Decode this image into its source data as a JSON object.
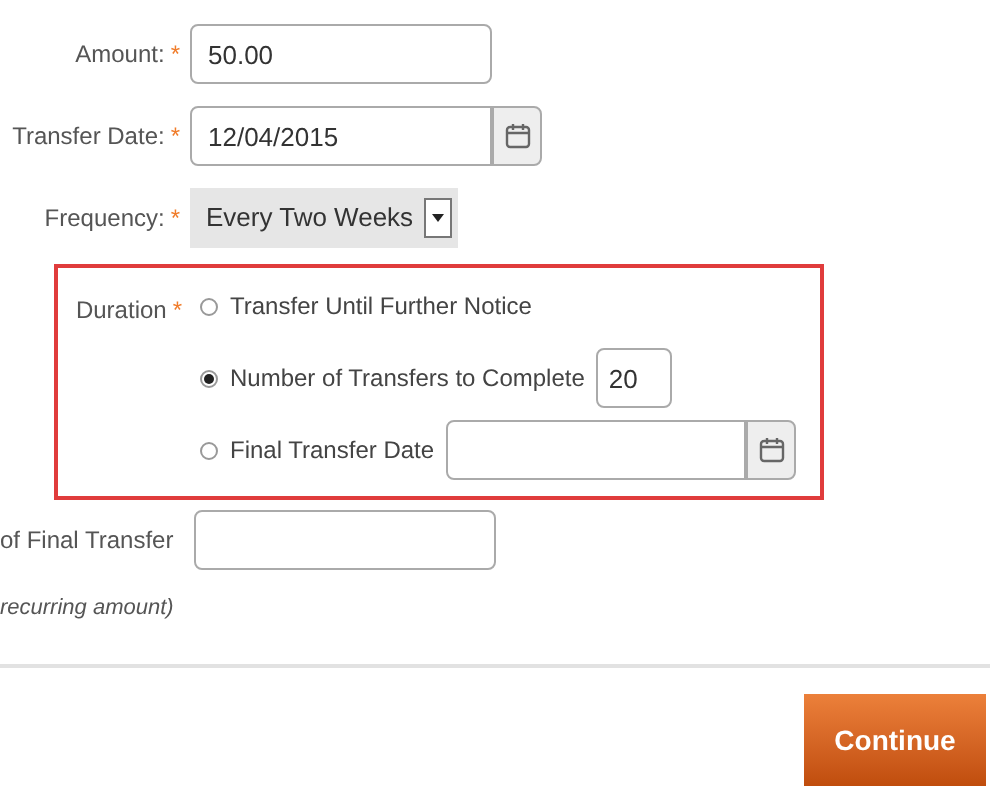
{
  "fields": [
    {
      "kind": "text",
      "label": "Amount:",
      "required_mark": "*",
      "value": "50.00"
    },
    {
      "kind": "date",
      "label": "Transfer Date:",
      "required_mark": "*",
      "value": "12/04/2015"
    },
    {
      "kind": "select",
      "label": "Frequency:",
      "required_mark": "*",
      "value": "Every Two Weeks"
    }
  ],
  "duration": {
    "label": "Duration",
    "required_mark": "*",
    "options": [
      {
        "kind": "plain",
        "label": "Transfer Until Further Notice",
        "selected": false
      },
      {
        "kind": "number",
        "label": "Number of Transfers to Complete",
        "selected": true,
        "value": "20"
      },
      {
        "kind": "date",
        "label": "Final Transfer Date",
        "selected": false
      }
    ]
  },
  "final_amount": {
    "label": "of Final Transfer",
    "note": "recurring amount)"
  },
  "continue_button": "Continue"
}
